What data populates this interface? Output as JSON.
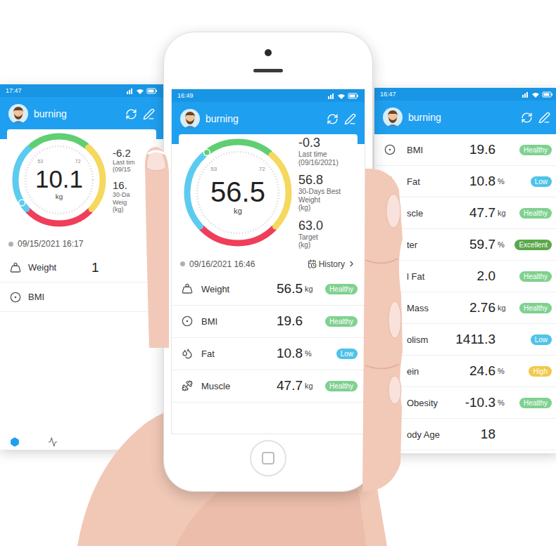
{
  "left_screen": {
    "status_time": "17:47",
    "user": "burning",
    "gauge": {
      "value": "10.1",
      "unit": "kg",
      "ticks": [
        "53",
        "72"
      ],
      "level": 0.05
    },
    "stats": [
      {
        "value": "-6.2",
        "label": [
          "Last tim",
          "(09/15"
        ]
      },
      {
        "value": "16.",
        "label": [
          "30-Da",
          "Weig",
          "(kg)"
        ]
      }
    ],
    "date": "09/15/2021 16:17",
    "rows": [
      {
        "label": "Weight",
        "value": "1"
      },
      {
        "label": "BMI"
      }
    ],
    "nav": [
      {
        "selected": true
      },
      {
        "selected": false
      }
    ]
  },
  "phone_screen": {
    "status_time": "16:49",
    "user": "burning",
    "gauge": {
      "value": "56.5",
      "unit": "kg",
      "ticks": [
        "53",
        "72"
      ],
      "level": 0.36
    },
    "stats": [
      {
        "value": "-0.3",
        "label": [
          "Last time",
          "(09/16/2021)"
        ]
      },
      {
        "value": "56.8",
        "label": [
          "30-Days Best",
          "Weight",
          "(kg)"
        ]
      },
      {
        "value": "63.0",
        "label": [
          "Target",
          "(kg)"
        ]
      }
    ],
    "date": "09/16/2021 16:46",
    "history": "History",
    "rows": [
      {
        "label": "Weight",
        "value": "56.5",
        "unit": "kg",
        "status": "Healthy",
        "color": "#7fd18f"
      },
      {
        "label": "BMI",
        "value": "19.6",
        "unit": "",
        "status": "Healthy",
        "color": "#7fd18f"
      },
      {
        "label": "Fat",
        "value": "10.8",
        "unit": "%",
        "status": "Low",
        "color": "#4fc3e8"
      },
      {
        "label": "Muscle",
        "value": "47.7",
        "unit": "kg",
        "status": "Healthy",
        "color": "#7fd18f"
      }
    ]
  },
  "right_screen": {
    "status_time": "16:47",
    "user": "burning",
    "rows": [
      {
        "label": "BMI",
        "value": "19.6",
        "unit": "",
        "status": "Healthy",
        "color": "#7fd18f"
      },
      {
        "label": "Fat",
        "value": "10.8",
        "unit": "%",
        "status": "Low",
        "color": "#4fc3e8"
      },
      {
        "label": "scle",
        "value": "47.7",
        "unit": "kg",
        "status": "Healthy",
        "color": "#7fd18f"
      },
      {
        "label": "ter",
        "value": "59.7",
        "unit": "%",
        "status": "Excellent",
        "color": "#5aa84a"
      },
      {
        "label": "l Fat",
        "value": "2.0",
        "unit": "",
        "status": "Healthy",
        "color": "#7fd18f"
      },
      {
        "label": "Mass",
        "value": "2.76",
        "unit": "kg",
        "status": "Healthy",
        "color": "#7fd18f"
      },
      {
        "label": "olism",
        "value": "1411.3",
        "unit": "",
        "status": "Low",
        "color": "#4fc3e8"
      },
      {
        "label": "ein",
        "value": "24.6",
        "unit": "%",
        "status": "High",
        "color": "#f2c94c"
      },
      {
        "label": "Obesity",
        "value": "-10.3",
        "unit": "%",
        "status": "Healthy",
        "color": "#7fd18f"
      },
      {
        "label": "ody Age",
        "value": "18"
      }
    ]
  }
}
